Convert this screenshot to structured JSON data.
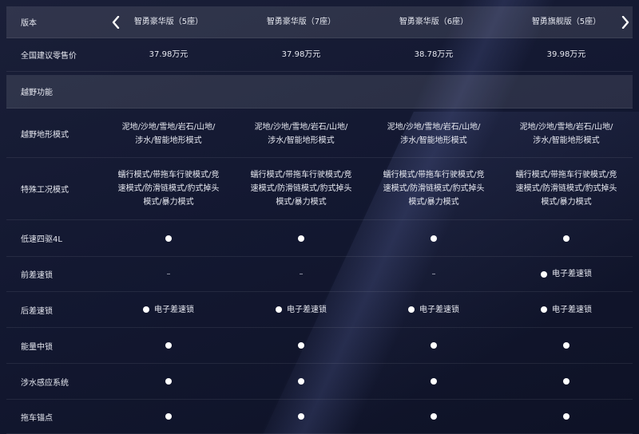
{
  "header": {
    "label": "版本",
    "models": [
      "智勇豪华版（5座）",
      "智勇豪华版（7座）",
      "智勇豪华版（6座）",
      "智勇旗舰版（5座）"
    ]
  },
  "price": {
    "label": "全国建议零售价",
    "values": [
      "37.98万元",
      "37.98万元",
      "38.78万元",
      "39.98万元"
    ]
  },
  "section": {
    "label": "越野功能"
  },
  "rows": [
    {
      "label": "越野地形模式",
      "values": [
        "泥地/沙地/雪地/岩石/山地/\n涉水/智能地形模式",
        "泥地/沙地/雪地/岩石/山地/\n涉水/智能地形模式",
        "泥地/沙地/雪地/岩石/山地/\n涉水/智能地形模式",
        "泥地/沙地/雪地/岩石/山地/\n涉水/智能地形模式"
      ]
    },
    {
      "label": "特殊工况模式",
      "values": [
        "蠕行模式/带拖车行驶模式/竞\n速模式/防滑链模式/豹式掉头\n模式/暴力模式",
        "蠕行模式/带拖车行驶模式/竞\n速模式/防滑链模式/豹式掉头\n模式/暴力模式",
        "蠕行模式/带拖车行驶模式/竞\n速模式/防滑链模式/豹式掉头\n模式/暴力模式",
        "蠕行模式/带拖车行驶模式/竞\n速模式/防滑链模式/豹式掉头\n模式/暴力模式"
      ]
    },
    {
      "label": "低速四驱4L",
      "values": [
        "●",
        "●",
        "●",
        "●"
      ]
    },
    {
      "label": "前差速锁",
      "values": [
        "–",
        "–",
        "–",
        "● 电子差速锁"
      ]
    },
    {
      "label": "后差速锁",
      "values": [
        "● 电子差速锁",
        "● 电子差速锁",
        "● 电子差速锁",
        "● 电子差速锁"
      ]
    },
    {
      "label": "能量中锁",
      "values": [
        "●",
        "●",
        "●",
        "●"
      ]
    },
    {
      "label": "涉水感应系统",
      "values": [
        "●",
        "●",
        "●",
        "●"
      ]
    },
    {
      "label": "拖车锚点",
      "values": [
        "●",
        "●",
        "●",
        "●"
      ]
    }
  ],
  "icons": {
    "prev": "chevron-left-icon",
    "next": "chevron-right-icon"
  }
}
